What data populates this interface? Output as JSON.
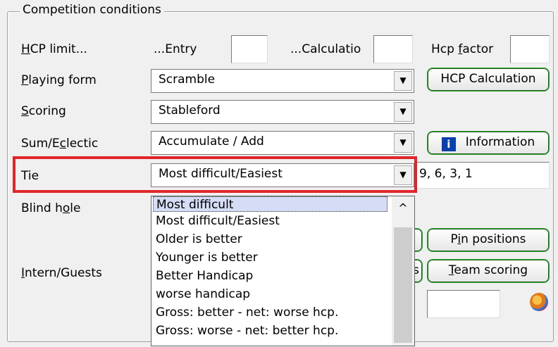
{
  "group": {
    "title": "Competition conditions"
  },
  "hcp": {
    "label_u": "H",
    "label_rest": "CP limit...",
    "entry_label": "...Entry",
    "entry_value": "",
    "calc_label": "...Calculatio",
    "calc_value": "",
    "factor_label_pre": "Hcp ",
    "factor_label_u": "f",
    "factor_label_post": "actor",
    "factor_value": ""
  },
  "playing_form": {
    "label_u": "P",
    "label_rest": "laying form",
    "value": "Scramble"
  },
  "scoring": {
    "label_u": "S",
    "label_rest": "coring",
    "value": "Stableford"
  },
  "sum": {
    "label_pre": "Sum/E",
    "label_u": "c",
    "label_rest": "lectic",
    "value": "Accumulate / Add"
  },
  "tie": {
    "label": "Tie",
    "value": "Most difficult/Easiest",
    "holes_value": "9, 6, 3, 1"
  },
  "blind_hole": {
    "label_pre": "Blind h",
    "label_u": "o",
    "label_rest": "le"
  },
  "intern": {
    "label_u": "I",
    "label_rest": "ntern/Guests"
  },
  "buttons": {
    "hcp_calc": "HCP Calculation",
    "information": "Information",
    "pin_pre": "P",
    "pin_u": "i",
    "pin_rest": "n positions",
    "team_u": "T",
    "team_rest": "eam scoring",
    "partial_s": "s"
  },
  "dropdown": {
    "items": [
      "Most difficult",
      "Most difficult/Easiest",
      "Older is better",
      "Younger is better",
      "Better Handicap",
      "worse handicap",
      "Gross: better - net: worse hcp.",
      "Gross: worse - net: better hcp."
    ],
    "selected_index": 0
  },
  "icons": {
    "dropdown_arrow": "▼",
    "scroll_up": "^",
    "info": "i"
  }
}
